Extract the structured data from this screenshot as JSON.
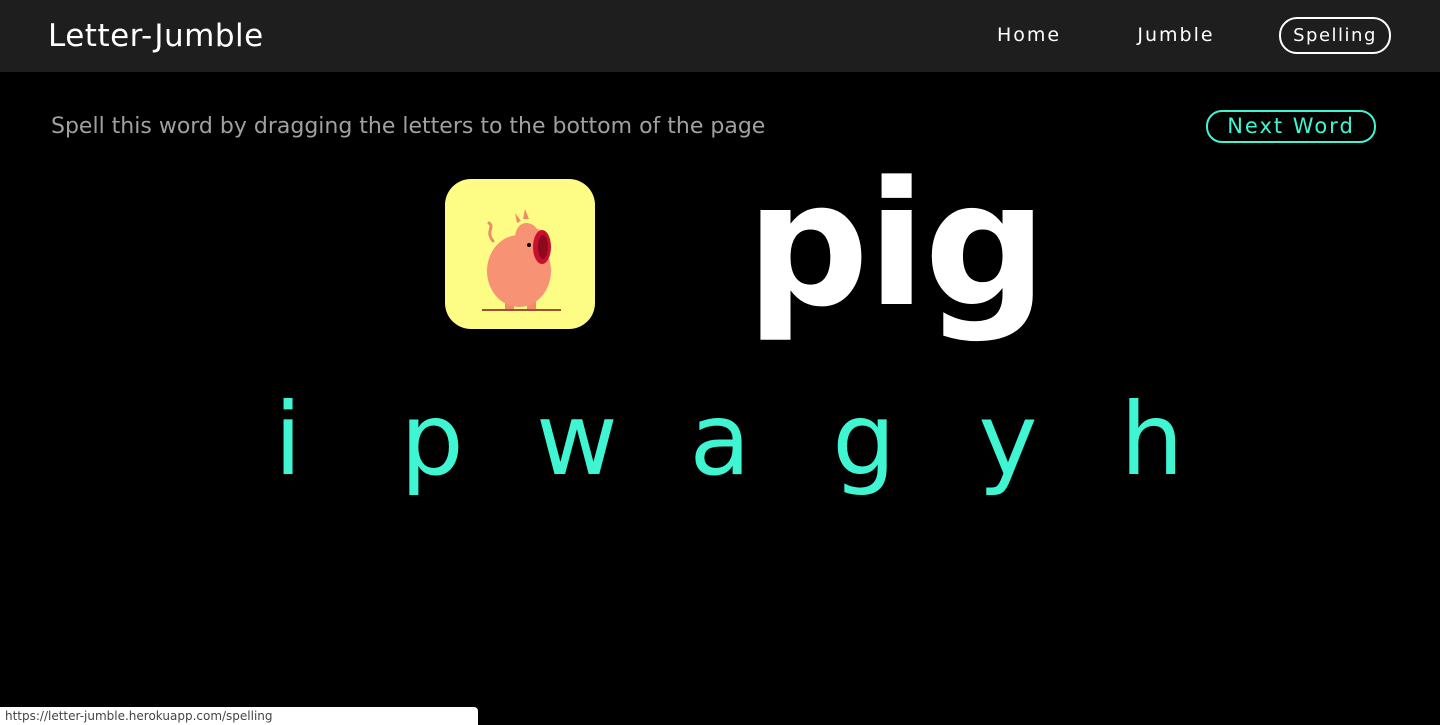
{
  "navbar": {
    "brand": "Letter-Jumble",
    "links": {
      "home": "Home",
      "jumble": "Jumble",
      "spelling": "Spelling"
    },
    "active": "spelling"
  },
  "game": {
    "instructions": "Spell this word by dragging the letters to the bottom of the page",
    "next_word_label": "Next Word",
    "picture_icon": "pig-icon",
    "target_word": "pig",
    "letters": [
      "i",
      "p",
      "w",
      "a",
      "g",
      "y",
      "h"
    ]
  },
  "status_bar": {
    "url": "https://letter-jumble.herokuapp.com/spelling"
  },
  "colors": {
    "accent": "#3ff5d2",
    "navbar_bg": "#1e1e1e",
    "page_bg": "#000000",
    "tile_bg": "#fdfd86"
  }
}
